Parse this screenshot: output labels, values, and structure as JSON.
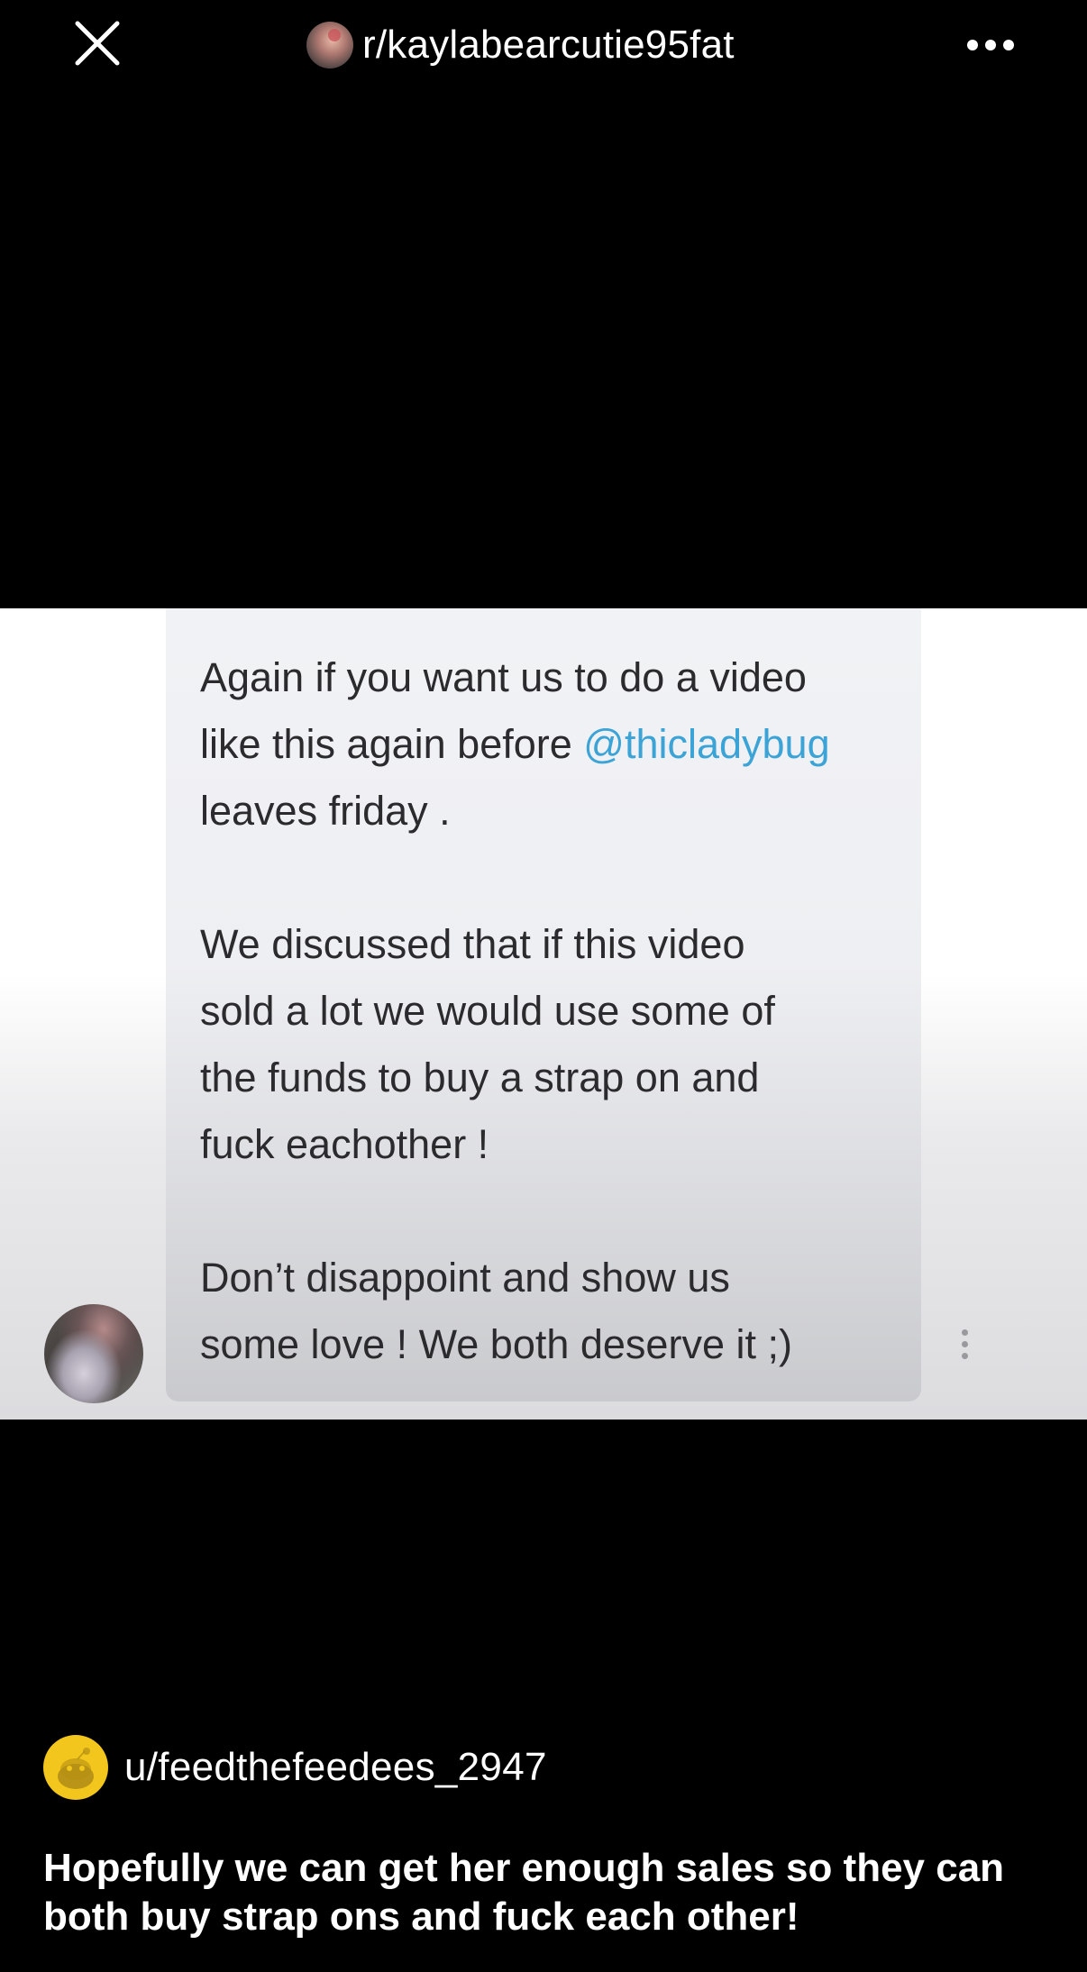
{
  "header": {
    "subreddit": "r/kaylabearcutie95fat",
    "close_icon": "close-icon",
    "more_icon": "more-horizontal-icon"
  },
  "screenshot": {
    "message_lines_1": "Again if you want us to do a video\nlike this again before ",
    "mention": "@thicladybug",
    "message_lines_1b": "\nleaves friday .",
    "message_paragraph_2": "We discussed that if this video\nsold a lot we would use some of\nthe funds to buy a strap on and\nfuck eachother !",
    "message_paragraph_3": "Don’t disappoint and show us\nsome love ! We both deserve it ;)",
    "mention_color": "#3ba3d6",
    "kebab_icon": "more-vertical-icon"
  },
  "post": {
    "author": "u/feedthefeedees_2947",
    "title": "Hopefully we can get her enough sales so they can both buy strap ons and fuck each other!"
  }
}
